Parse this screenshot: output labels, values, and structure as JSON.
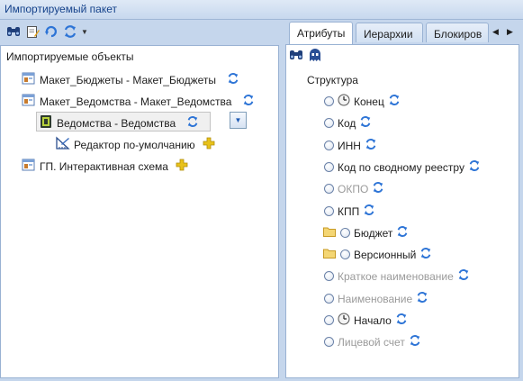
{
  "window": {
    "title": "Импортируемый пакет"
  },
  "left_toolbar": {
    "buttons": [
      {
        "icon": "binoculars-icon"
      },
      {
        "icon": "edit-icon"
      },
      {
        "icon": "refresh-arrow-icon"
      },
      {
        "icon": "sync-icon"
      }
    ]
  },
  "left_tree": {
    "root": "Импортируемые объекты",
    "items": [
      {
        "label": "Макет_Бюджеты - Макет_Бюджеты",
        "icon": "layout-icon"
      },
      {
        "label": "Макет_Ведомства - Макет_Ведомства",
        "icon": "layout-icon"
      },
      {
        "label": "Ведомства - Ведомства",
        "icon": "dictionary-icon",
        "selected": true
      },
      {
        "label": "Редактор по-умолчанию",
        "icon": "editor-icon"
      },
      {
        "label": "ГП. Интерактивная схема",
        "icon": "layout-icon"
      }
    ]
  },
  "tabs": [
    {
      "label": "Атрибуты",
      "active": true
    },
    {
      "label": "Иерархии",
      "active": false
    },
    {
      "label": "Блокиров",
      "active": false
    }
  ],
  "right_toolbar": {
    "buttons": [
      {
        "icon": "binoculars-icon"
      },
      {
        "icon": "ghost-icon"
      }
    ]
  },
  "attributes": {
    "root": "Структура",
    "items": [
      {
        "label": "Конец",
        "clock": true,
        "folder": false,
        "disabled": false
      },
      {
        "label": "Код",
        "clock": false,
        "folder": false,
        "disabled": false
      },
      {
        "label": "ИНН",
        "clock": false,
        "folder": false,
        "disabled": false
      },
      {
        "label": "Код по сводному реестру",
        "clock": false,
        "folder": false,
        "disabled": false
      },
      {
        "label": "ОКПО",
        "clock": false,
        "folder": false,
        "disabled": true
      },
      {
        "label": "КПП",
        "clock": false,
        "folder": false,
        "disabled": false
      },
      {
        "label": "Бюджет",
        "clock": false,
        "folder": true,
        "disabled": false
      },
      {
        "label": "Версионный",
        "clock": false,
        "folder": true,
        "disabled": false
      },
      {
        "label": "Краткое наименование",
        "clock": false,
        "folder": false,
        "disabled": true
      },
      {
        "label": "Наименование",
        "clock": false,
        "folder": false,
        "disabled": true
      },
      {
        "label": "Начало",
        "clock": true,
        "folder": false,
        "disabled": false
      },
      {
        "label": "Лицевой счет",
        "clock": false,
        "folder": false,
        "disabled": true
      }
    ]
  },
  "colors": {
    "sync_blue": "#2d74d6",
    "add_yellow": "#e8c21a",
    "frame": "#c5d6ec",
    "disabled_text": "#9a9a9a"
  }
}
